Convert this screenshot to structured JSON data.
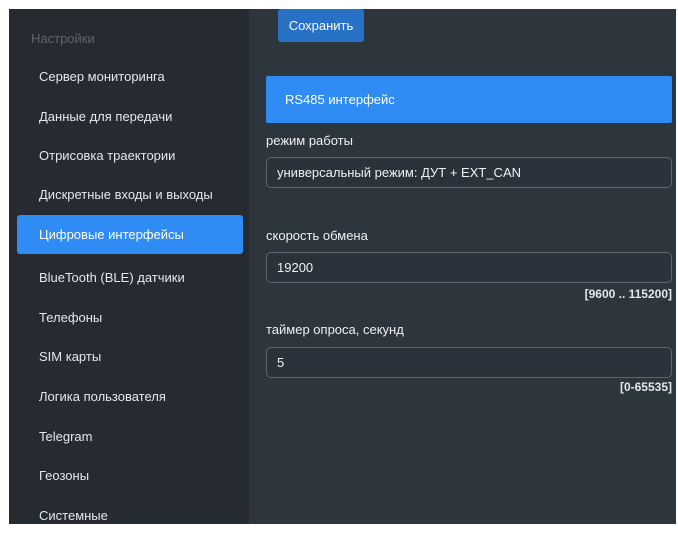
{
  "sidebar": {
    "title": "Настройки",
    "items": [
      {
        "label": "Сервер мониторинга"
      },
      {
        "label": "Данные для передачи"
      },
      {
        "label": "Отрисовка траектории"
      },
      {
        "label": "Дискретные входы и выходы"
      },
      {
        "label": "Цифровые интерфейсы",
        "active": true
      },
      {
        "label": "BlueTooth (BLE) датчики"
      },
      {
        "label": "Телефоны"
      },
      {
        "label": "SIM карты"
      },
      {
        "label": "Логика пользователя"
      },
      {
        "label": "Telegram"
      },
      {
        "label": "Геозоны"
      },
      {
        "label": "Системные"
      }
    ]
  },
  "toolbar": {
    "save_label": "Сохранить"
  },
  "section": {
    "title": "RS485 интерфейс"
  },
  "fields": {
    "mode": {
      "label": "режим работы",
      "value": "универсальный режим: ДУТ + EXT_CAN"
    },
    "speed": {
      "label": "скорость обмена",
      "value": "19200",
      "range": "[9600 .. 115200]"
    },
    "timer": {
      "label": "таймер опроса, секунд",
      "value": "5",
      "range": "[0-65535]"
    }
  },
  "colors": {
    "accent": "#2f8cf4",
    "save_button": "#2771c6",
    "sidebar_bg": "#252b30",
    "main_bg": "#2d353d"
  }
}
